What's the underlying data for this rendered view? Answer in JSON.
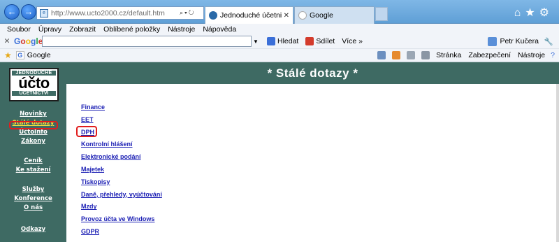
{
  "browser": {
    "url": "http://www.ucto2000.cz/default.htm",
    "tabs": [
      {
        "label": "Jednoduché účetnictví a da...",
        "active": true
      },
      {
        "label": "Google",
        "active": false
      }
    ]
  },
  "menu": [
    "Soubor",
    "Úpravy",
    "Zobrazit",
    "Oblíbené položky",
    "Nástroje",
    "Nápověda"
  ],
  "google_toolbar": {
    "logo": "Google",
    "search_value": "",
    "items": [
      "Hledat",
      "Sdílet",
      "Více »"
    ],
    "user": "Petr Kučera"
  },
  "favorites_bar": {
    "items": [
      "Google"
    ],
    "commands": [
      "Stránka",
      "Zabezpečení",
      "Nástroje"
    ]
  },
  "site": {
    "logo": {
      "top": "JEDNODUCHÉ",
      "middle": "účto",
      "bottom": "ÚČETNICTVÍ"
    },
    "left_nav": [
      "Novinky",
      "Stálé dotazy",
      "ÚčtoInfo",
      "Zákony",
      "Ceník",
      "Ke stažení",
      "Služby",
      "Konference",
      "O nás",
      "Odkazy"
    ],
    "selected_left": "Stálé dotazy",
    "header": "* Stálé dotazy *",
    "topics": [
      "Finance",
      "EET",
      "DPH",
      "Kontrolní hlášení",
      "Elektronické podání",
      "Majetek",
      "Tiskopisy",
      "Daně, přehledy, vyúčtování",
      "Mzdy",
      "Provoz účta ve Windows",
      "GDPR"
    ]
  },
  "colors": {
    "site_green": "#3e6a63",
    "link_blue": "#1e22b5",
    "highlight_red": "#e11d1d"
  }
}
